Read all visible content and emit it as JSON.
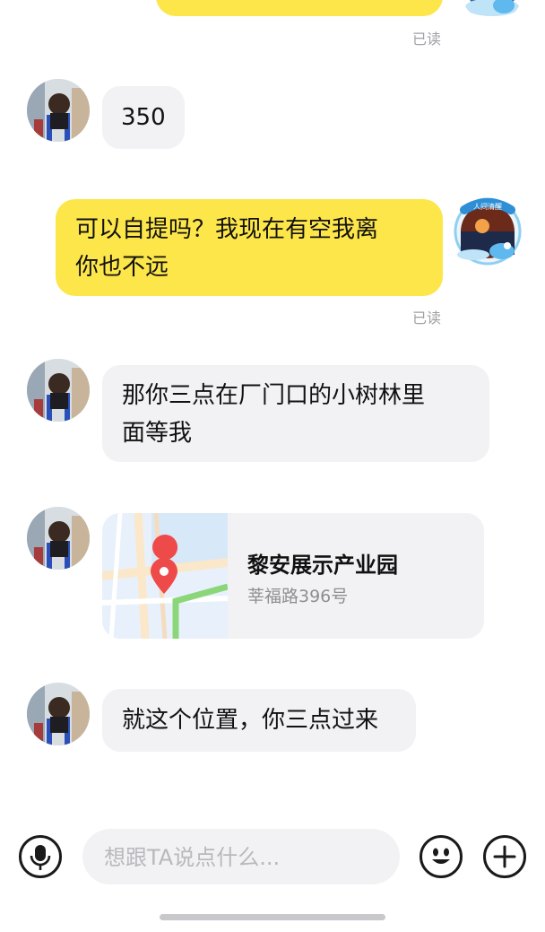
{
  "messages": [
    {
      "id": "m1",
      "side": "out",
      "text": "",
      "status": "已读"
    },
    {
      "id": "m2",
      "side": "in",
      "text": "350"
    },
    {
      "id": "m3",
      "side": "out",
      "lines": [
        "可以自提吗？我现在有空我离",
        "你也不远"
      ],
      "status": "已读"
    },
    {
      "id": "m4",
      "side": "in",
      "lines": [
        "那你三点在厂门口的小树林里",
        "面等我"
      ]
    },
    {
      "id": "m5",
      "side": "in",
      "type": "location",
      "title": "黎安展示产业园",
      "address": "莘福路396号"
    },
    {
      "id": "m6",
      "side": "in",
      "text": "就这个位置，你三点过来"
    }
  ],
  "self_avatar": {
    "badge_text": "人间清醒"
  },
  "composer": {
    "placeholder": "想跟TA说点什么...",
    "voice_icon": "microphone-icon",
    "emoji_icon": "emoji-icon",
    "plus_icon": "plus-icon"
  },
  "colors": {
    "outgoing_bubble": "#fde64a",
    "incoming_bubble": "#f2f2f4",
    "read_status": "#a0a0a5"
  }
}
